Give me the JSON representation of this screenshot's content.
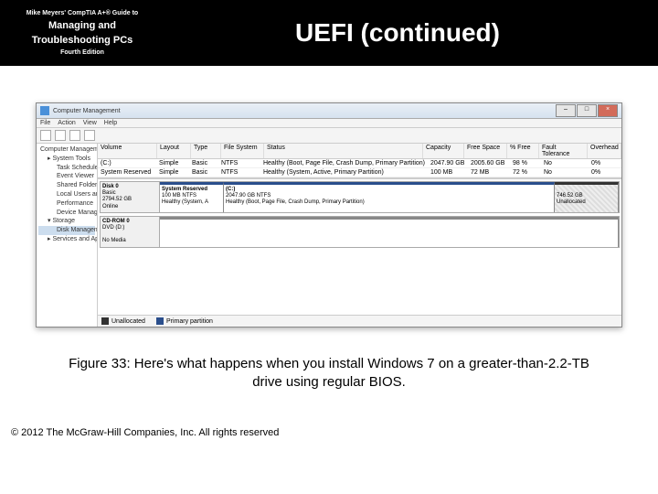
{
  "header": {
    "guide_line": "Mike Meyers' CompTIA A+® Guide to",
    "book_title_1": "Managing and",
    "book_title_2": "Troubleshooting PCs",
    "edition": "Fourth Edition",
    "slide_title": "UEFI (continued)"
  },
  "win": {
    "title": "Computer Management",
    "menu": [
      "File",
      "Action",
      "View",
      "Help"
    ],
    "tree": {
      "root": "Computer Management (Local)",
      "system_tools": "System Tools",
      "items": [
        "Task Scheduler",
        "Event Viewer",
        "Shared Folders",
        "Local Users and Groups",
        "Performance",
        "Device Manager"
      ],
      "storage": "Storage",
      "disk_mgmt": "Disk Management",
      "services": "Services and Applications"
    },
    "vol_headers": [
      "Volume",
      "Layout",
      "Type",
      "File System",
      "Status",
      "Capacity",
      "Free Space",
      "% Free",
      "Fault Tolerance",
      "Overhead"
    ],
    "volumes": [
      {
        "v": "(C:)",
        "lay": "Simple",
        "typ": "Basic",
        "fs": "NTFS",
        "stat": "Healthy (Boot, Page File, Crash Dump, Primary Partition)",
        "cap": "2047.90 GB",
        "free": "2005.60 GB",
        "pct": "98 %",
        "ft": "No",
        "ov": "0%"
      },
      {
        "v": "System Reserved",
        "lay": "Simple",
        "typ": "Basic",
        "fs": "NTFS",
        "stat": "Healthy (System, Active, Primary Partition)",
        "cap": "100 MB",
        "free": "72 MB",
        "pct": "72 %",
        "ft": "No",
        "ov": "0%"
      }
    ],
    "disk0": {
      "name": "Disk 0",
      "type": "Basic",
      "size": "2794.52 GB",
      "state": "Online",
      "p1": {
        "t": "System Reserved",
        "s": "100 MB NTFS",
        "st": "Healthy (System, A"
      },
      "p2": {
        "t": "(C:)",
        "s": "2047.90 GB NTFS",
        "st": "Healthy (Boot, Page File, Crash Dump, Primary Partition)"
      },
      "p3": {
        "s": "746.52 GB",
        "st": "Unallocated"
      }
    },
    "cd": {
      "name": "CD-ROM 0",
      "type": "DVD (D:)",
      "state": "No Media"
    },
    "legend": {
      "un": "Unallocated",
      "pr": "Primary partition"
    }
  },
  "caption": "Figure 33: Here's what happens when you install Windows 7 on a greater-than-2.2-TB drive using regular BIOS.",
  "copyright": "© 2012 The McGraw-Hill Companies, Inc. All rights reserved"
}
